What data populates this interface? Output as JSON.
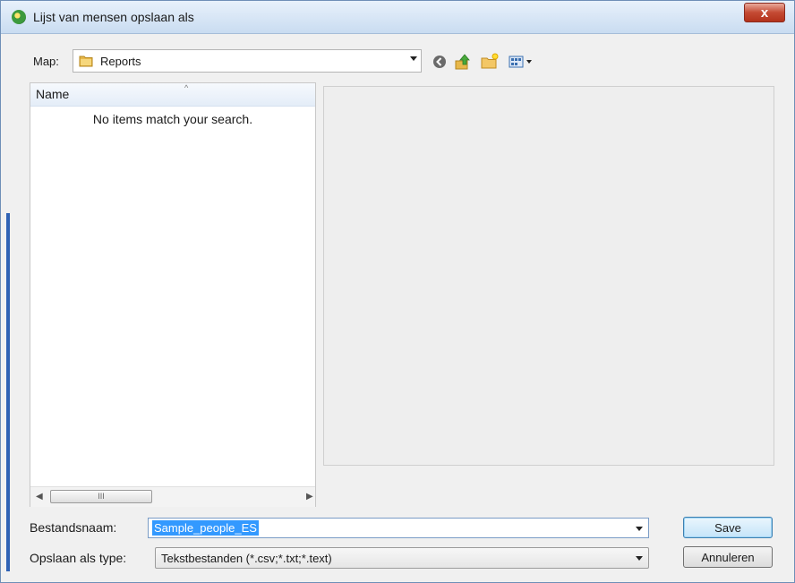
{
  "window": {
    "title": "Lijst van mensen opslaan als",
    "close_label": "x"
  },
  "location": {
    "label": "Map:",
    "value": "Reports"
  },
  "toolbar": {
    "icons": [
      "back-icon",
      "up-folder-icon",
      "new-folder-icon",
      "view-menu-icon"
    ]
  },
  "file_list": {
    "columns": [
      "Name"
    ],
    "empty_message": "No items match your search.",
    "scroll_thumb": "III"
  },
  "filename": {
    "label": "Bestandsnaam:",
    "value": "Sample_people_ES"
  },
  "filetype": {
    "label": "Opslaan als type:",
    "value": "Tekstbestanden (*.csv;*.txt;*.text)"
  },
  "buttons": {
    "save": "Save",
    "cancel": "Annuleren"
  },
  "colors": {
    "selection": "#3399ff",
    "close_button": "#c44a33"
  }
}
